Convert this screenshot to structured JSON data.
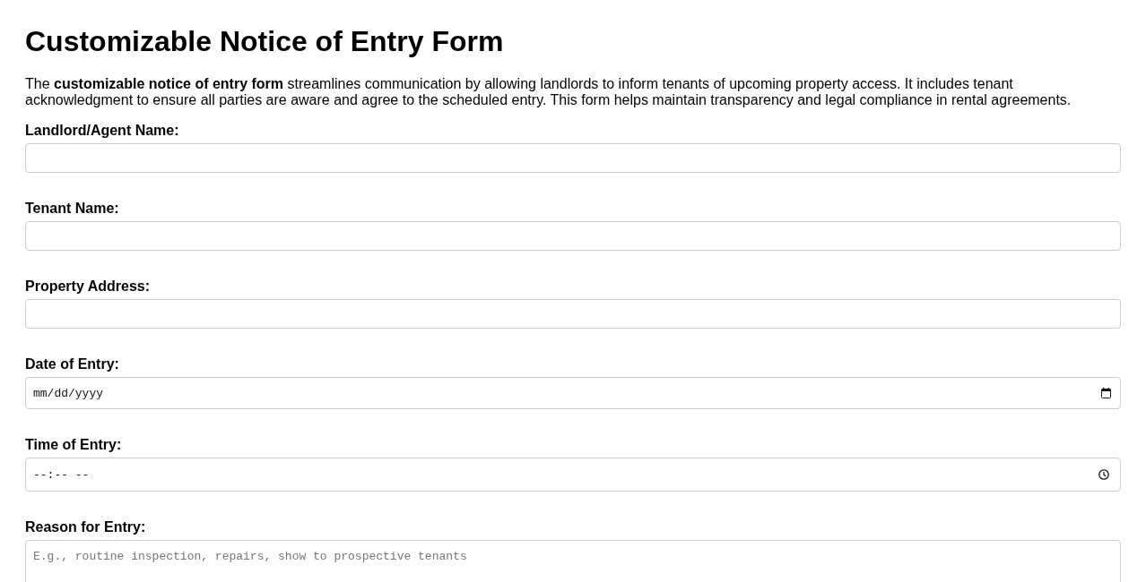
{
  "title": "Customizable Notice of Entry Form",
  "intro": "The **customizable notice of entry form** streamlines communication by allowing landlords to inform tenants of upcoming property access. It includes tenant acknowledgment to ensure all parties are aware and agree to the scheduled entry. This form helps maintain transparency and legal compliance in rental agreements.",
  "fields": [
    {
      "kind": "text",
      "label": "Landlord/Agent Name:"
    },
    {
      "kind": "text",
      "label": "Tenant Name:"
    },
    {
      "kind": "text",
      "label": "Property Address:"
    },
    {
      "kind": "date",
      "label": "Date of Entry:",
      "placeholder": "mm/dd/yyyy"
    },
    {
      "kind": "time",
      "label": "Time of Entry:",
      "placeholder": "--:-- --"
    },
    {
      "kind": "textarea",
      "label": "Reason for Entry:",
      "placeholder": "E.g., routine inspection, repairs, show to prospective tenants"
    }
  ]
}
